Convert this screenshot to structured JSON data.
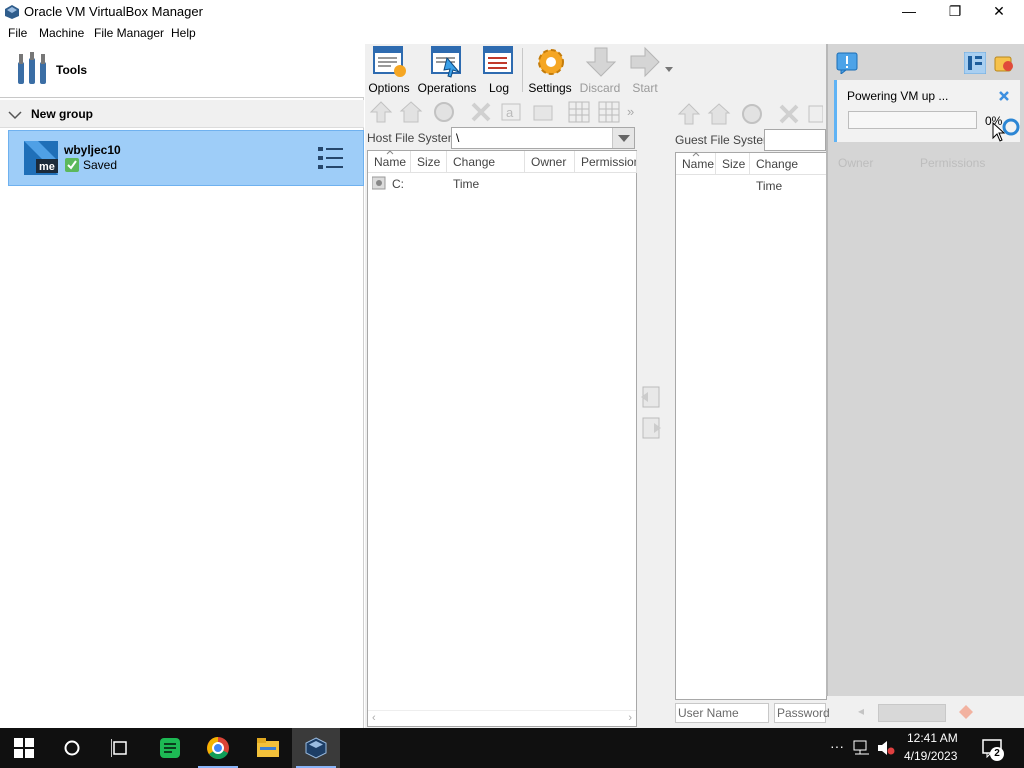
{
  "window": {
    "title": "Oracle VM VirtualBox Manager",
    "minimize": "—",
    "restore": "❐",
    "close": "✕"
  },
  "menu": [
    "File",
    "Machine",
    "File Manager",
    "Help"
  ],
  "left": {
    "tools_label": "Tools",
    "group_label": "New group",
    "vm": {
      "name": "wbyljec10",
      "state": "Saved"
    }
  },
  "toolbar": {
    "options": "Options",
    "operations": "Operations",
    "log": "Log",
    "settings": "Settings",
    "discard": "Discard",
    "start": "Start"
  },
  "host": {
    "fs_label": "Host File System:",
    "path": "\\",
    "columns": [
      "Name",
      "Size",
      "Change Time",
      "Owner",
      "Permissions"
    ],
    "rows": [
      {
        "name": "C:"
      }
    ]
  },
  "guest": {
    "fs_label": "Guest File System:",
    "columns": [
      "Name",
      "Size",
      "Change Time",
      "Owner",
      "Permissions"
    ],
    "username_placeholder": "User Name",
    "password_placeholder": "Password"
  },
  "notification": {
    "message": "Powering VM up ...",
    "progress_percent": 0,
    "progress_text": "0%"
  },
  "taskbar": {
    "time": "12:41 AM",
    "date": "4/19/2023",
    "notifications_count": "2",
    "overflow": "···"
  },
  "colors": {
    "selection": "#9ecdf8",
    "accent": "#1c7dd8",
    "taskbar": "#101010"
  }
}
